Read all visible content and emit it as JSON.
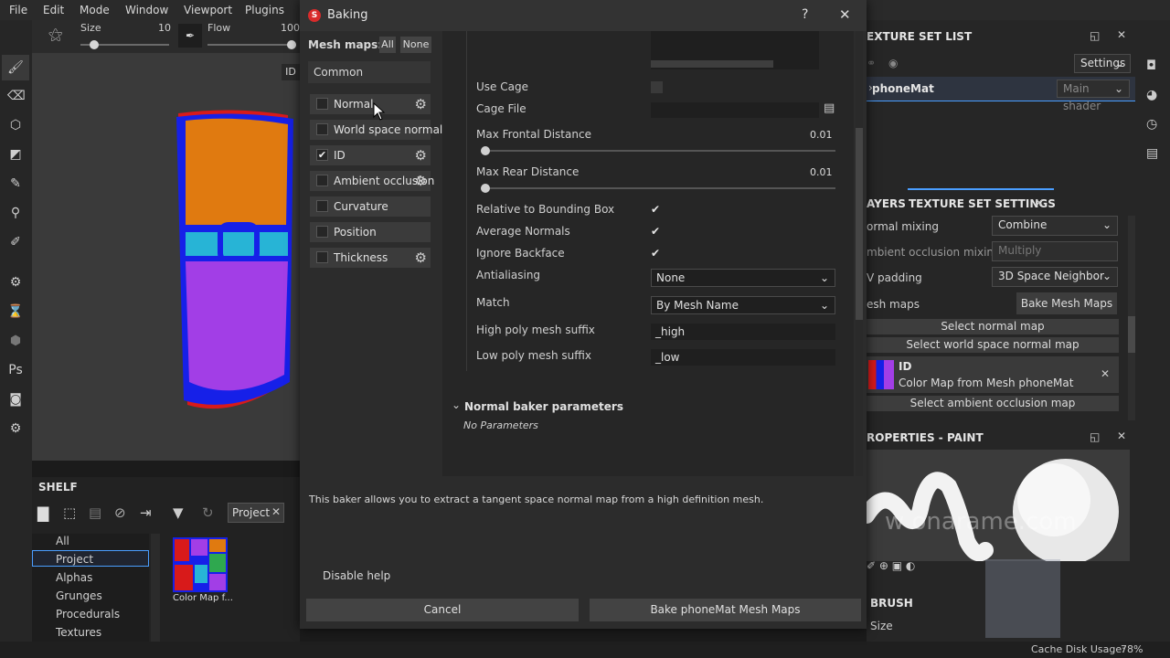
{
  "menu": [
    "File",
    "Edit",
    "Mode",
    "Window",
    "Viewport",
    "Plugins"
  ],
  "tool_options": {
    "size_label": "Size",
    "size_value": "10",
    "size_fraction": 0.12,
    "flow_label": "Flow",
    "flow_value": "100",
    "flow_fraction": 1.0,
    "viewport_badge": "ID"
  },
  "dialog": {
    "title": "Baking",
    "help_glyph": "?",
    "close_glyph": "✕",
    "mesh_maps_label": "Mesh maps:",
    "all_label": "All",
    "none_label": "None",
    "common_label": "Common",
    "maps": [
      {
        "label": "Normal",
        "checked": false,
        "gear": true
      },
      {
        "label": "World space normal",
        "checked": false,
        "gear": false
      },
      {
        "label": "ID",
        "checked": true,
        "gear": true
      },
      {
        "label": "Ambient occlusion",
        "checked": false,
        "gear": true
      },
      {
        "label": "Curvature",
        "checked": false,
        "gear": false
      },
      {
        "label": "Position",
        "checked": false,
        "gear": false
      },
      {
        "label": "Thickness",
        "checked": false,
        "gear": true
      }
    ],
    "params": {
      "use_cage": "Use Cage",
      "cage_file": "Cage File",
      "max_frontal": "Max Frontal Distance",
      "max_frontal_value": "0.01",
      "max_rear": "Max Rear Distance",
      "max_rear_value": "0.01",
      "relative_bbox": "Relative to Bounding Box",
      "average_normals": "Average Normals",
      "ignore_backface": "Ignore Backface",
      "antialiasing": "Antialiasing",
      "antialiasing_value": "None",
      "match": "Match",
      "match_value": "By Mesh Name",
      "high_suffix": "High poly mesh suffix",
      "high_suffix_value": "_high",
      "low_suffix": "Low poly mesh suffix",
      "low_suffix_value": "_low"
    },
    "normal_baker": "Normal baker parameters",
    "no_params": "No Parameters",
    "help_text": "This baker allows you to extract a tangent space normal map from a high definition mesh.",
    "disable_help": "Disable help",
    "cancel": "Cancel",
    "bake": "Bake phoneMat Mesh Maps"
  },
  "shelf": {
    "title": "SHELF",
    "tab": "Project",
    "categories": [
      "All",
      "Project",
      "Alphas",
      "Grunges",
      "Procedurals",
      "Textures"
    ],
    "selected": "Project",
    "thumb_label": "Color Map f..."
  },
  "texture_set_list": {
    "title": "EXTURE SET LIST",
    "settings": "Settings",
    "item": "phoneMat",
    "shader": "Main shader"
  },
  "texture_set_settings": {
    "tab_layers": "AYERS",
    "tab_settings": "TEXTURE SET SETTINGS",
    "normal_mixing": "ormal mixing",
    "normal_mixing_value": "Combine",
    "ao_mixing": "mbient occlusion mixing",
    "ao_mixing_value": "Multiply",
    "uv_padding": "V padding",
    "uv_padding_value": "3D Space Neighbor",
    "mesh_maps": "esh maps",
    "bake_btn": "Bake Mesh Maps",
    "select_normal": "Select normal map",
    "select_world": "Select world space normal map",
    "id_title": "ID",
    "id_sub": "Color Map from Mesh phoneMat",
    "select_ao": "Select ambient occlusion map"
  },
  "properties": {
    "title": "ROPERTIES - PAINT",
    "watermark": "w   onarame.com",
    "brush": "BRUSH",
    "size": "Size"
  },
  "status": {
    "cache": "Cache Disk Usage:",
    "cache_value": "78%"
  },
  "colors": {
    "accent": "#4a9eff",
    "phone_orange": "#e07a10",
    "phone_cyan": "#27b4d6",
    "phone_purple": "#a23ee6",
    "phone_blue": "#1620e8"
  }
}
